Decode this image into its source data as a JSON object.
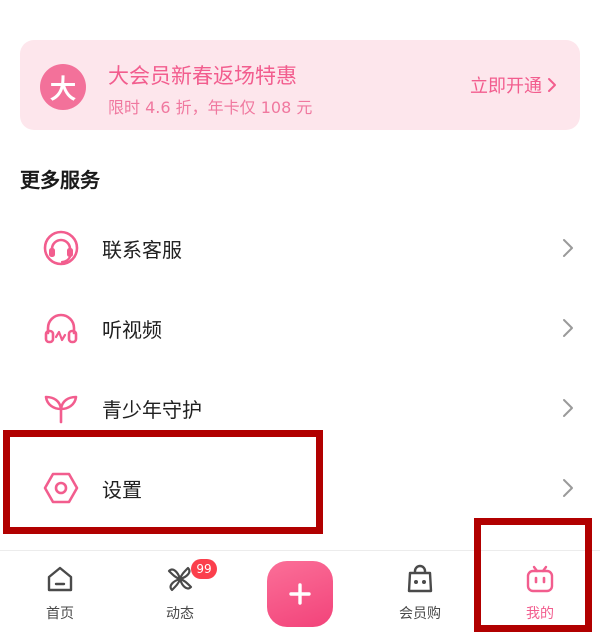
{
  "vip_banner": {
    "badge": "大",
    "title": "大会员新春返场特惠",
    "subtitle": "限时 4.6 折，年卡仅 108 元",
    "cta": "立即开通"
  },
  "more_services": {
    "title": "更多服务",
    "items": [
      {
        "label": "联系客服",
        "icon": "headset-icon"
      },
      {
        "label": "听视频",
        "icon": "headphones-icon"
      },
      {
        "label": "青少年守护",
        "icon": "sprout-icon"
      },
      {
        "label": "设置",
        "icon": "hexagon-settings-icon"
      }
    ]
  },
  "tabbar": {
    "home": "首页",
    "dynamic": "动态",
    "dynamic_badge": "99",
    "shop": "会员购",
    "mine": "我的"
  },
  "colors": {
    "accent": "#f25d8e",
    "banner_bg": "#fde6ec",
    "highlight": "#b10000",
    "badge": "#fb3f4c"
  }
}
